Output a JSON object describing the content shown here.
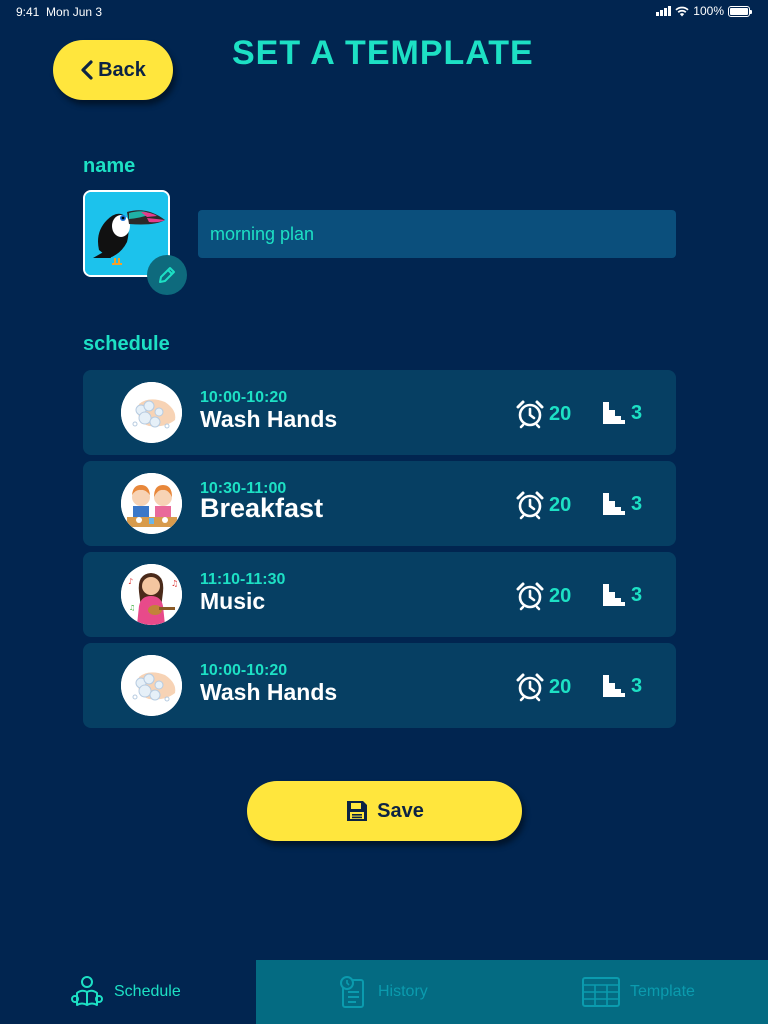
{
  "status_bar": {
    "time": "9:41",
    "date": "Mon Jun 3",
    "battery": "100%"
  },
  "header": {
    "back_label": "Back",
    "title": "SET A TEMPLATE"
  },
  "name_section": {
    "label": "name",
    "value": "morning plan"
  },
  "schedule_section": {
    "label": "schedule",
    "items": [
      {
        "time": "10:00-10:20",
        "name": "Wash Hands",
        "duration": "20",
        "steps": "3",
        "icon": "wash-hands-icon"
      },
      {
        "time": "10:30-11:00",
        "name": "Breakfast",
        "duration": "20",
        "steps": "3",
        "icon": "breakfast-icon"
      },
      {
        "time": "11:10-11:30",
        "name": "Music",
        "duration": "20",
        "steps": "3",
        "icon": "music-icon"
      },
      {
        "time": "10:00-10:20",
        "name": "Wash Hands",
        "duration": "20",
        "steps": "3",
        "icon": "wash-hands-icon"
      }
    ]
  },
  "save_label": "Save",
  "tabs": [
    {
      "label": "Schedule",
      "icon": "reading-person-icon",
      "active": true
    },
    {
      "label": "History",
      "icon": "clipboard-icon",
      "active": false
    },
    {
      "label": "Template",
      "icon": "calendar-grid-icon",
      "active": false
    }
  ],
  "colors": {
    "background": "#012550",
    "accent": "#1de0c4",
    "button": "#ffe63d",
    "card": "#063f63",
    "input": "#0b4f7c",
    "tab_inactive": "#046b82"
  }
}
